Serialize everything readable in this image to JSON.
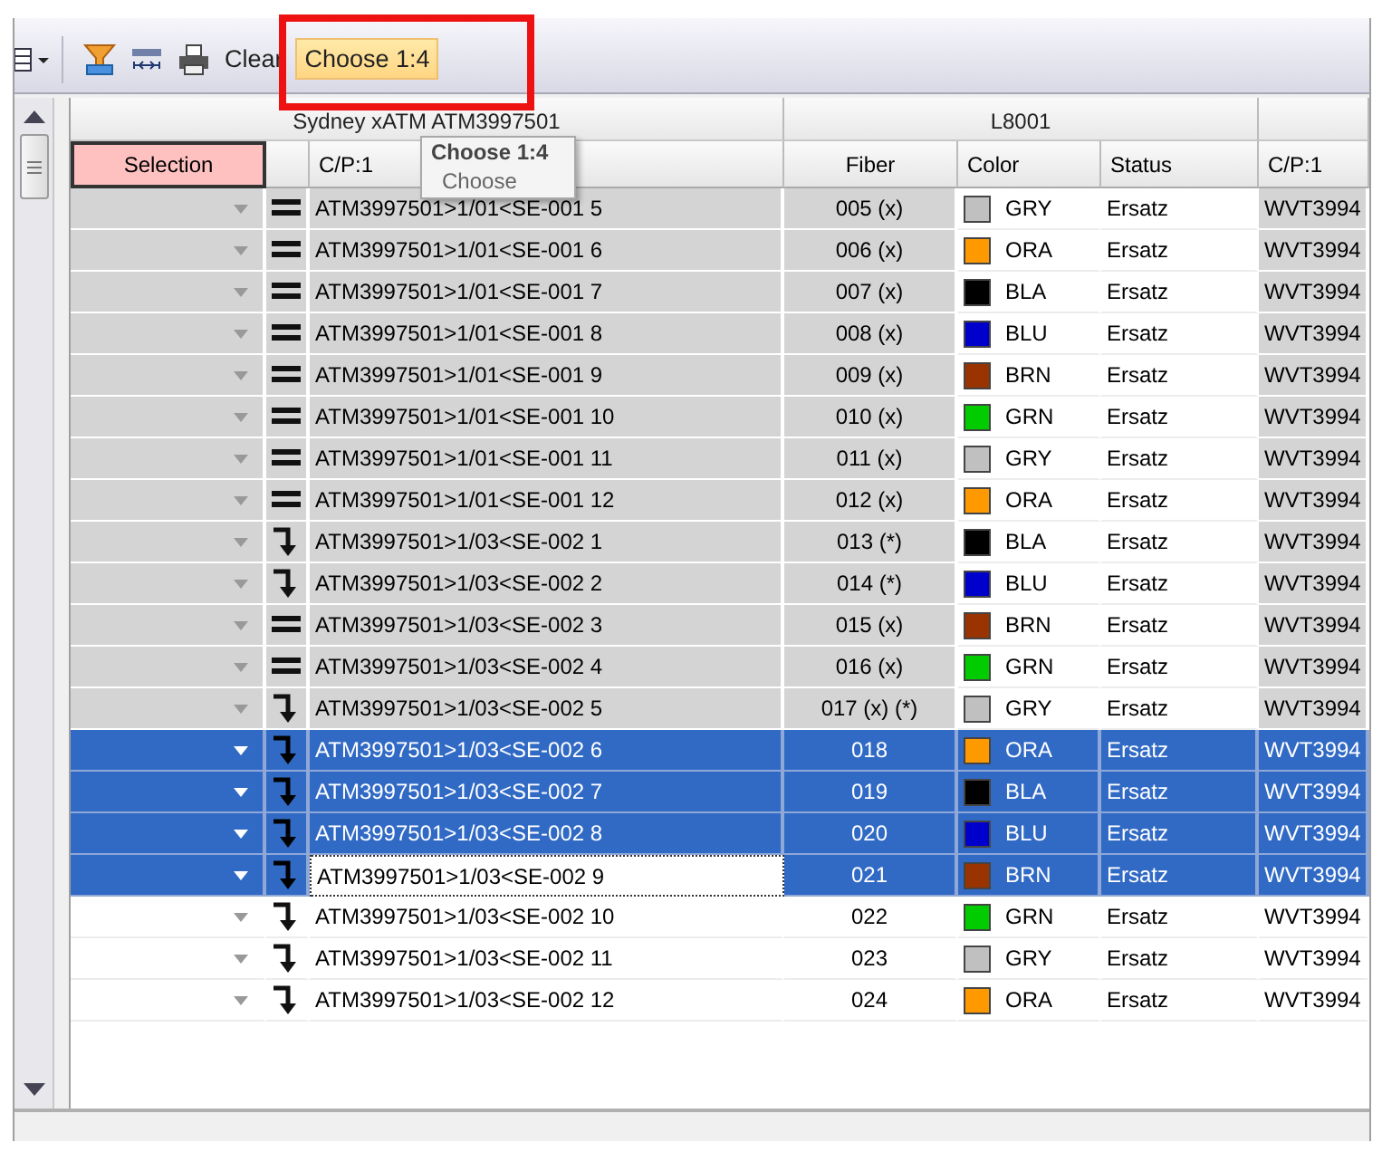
{
  "toolbar": {
    "clear_label": "Clear",
    "choose_button": {
      "label": "Choose 1:4",
      "hovered": true
    }
  },
  "tooltip": {
    "title": "Choose 1:4",
    "text": "Choose"
  },
  "grid": {
    "group_headers": [
      "Sydney xATM ATM3997501",
      "L8001"
    ],
    "columns": [
      {
        "label": "Selection",
        "selected": true
      },
      {
        "label": "C/P:1",
        "selected": false
      },
      {
        "label": "Fiber",
        "selected": false
      },
      {
        "label": "Color",
        "selected": false
      },
      {
        "label": "Status",
        "selected": false
      },
      {
        "label": "C/P:1",
        "selected": false
      }
    ],
    "rows": [
      {
        "kind": "equal",
        "cp": "ATM3997501>1/01<SE-001 5",
        "fiber": "005 (x)",
        "color": "#c0c0c0",
        "color_code": "GRY",
        "status": "Ersatz",
        "cp2": "WVT3994",
        "greyed": true,
        "selected": false,
        "focused": false
      },
      {
        "kind": "equal",
        "cp": "ATM3997501>1/01<SE-001 6",
        "fiber": "006 (x)",
        "color": "#ff9900",
        "color_code": "ORA",
        "status": "Ersatz",
        "cp2": "WVT3994",
        "greyed": true,
        "selected": false,
        "focused": false
      },
      {
        "kind": "equal",
        "cp": "ATM3997501>1/01<SE-001 7",
        "fiber": "007 (x)",
        "color": "#000000",
        "color_code": "BLA",
        "status": "Ersatz",
        "cp2": "WVT3994",
        "greyed": true,
        "selected": false,
        "focused": false
      },
      {
        "kind": "equal",
        "cp": "ATM3997501>1/01<SE-001 8",
        "fiber": "008 (x)",
        "color": "#0000cc",
        "color_code": "BLU",
        "status": "Ersatz",
        "cp2": "WVT3994",
        "greyed": true,
        "selected": false,
        "focused": false
      },
      {
        "kind": "equal",
        "cp": "ATM3997501>1/01<SE-001 9",
        "fiber": "009 (x)",
        "color": "#993300",
        "color_code": "BRN",
        "status": "Ersatz",
        "cp2": "WVT3994",
        "greyed": true,
        "selected": false,
        "focused": false
      },
      {
        "kind": "equal",
        "cp": "ATM3997501>1/01<SE-001 10",
        "fiber": "010 (x)",
        "color": "#00cc00",
        "color_code": "GRN",
        "status": "Ersatz",
        "cp2": "WVT3994",
        "greyed": true,
        "selected": false,
        "focused": false
      },
      {
        "kind": "equal",
        "cp": "ATM3997501>1/01<SE-001 11",
        "fiber": "011 (x)",
        "color": "#c0c0c0",
        "color_code": "GRY",
        "status": "Ersatz",
        "cp2": "WVT3994",
        "greyed": true,
        "selected": false,
        "focused": false
      },
      {
        "kind": "equal",
        "cp": "ATM3997501>1/01<SE-001 12",
        "fiber": "012 (x)",
        "color": "#ff9900",
        "color_code": "ORA",
        "status": "Ersatz",
        "cp2": "WVT3994",
        "greyed": true,
        "selected": false,
        "focused": false
      },
      {
        "kind": "turn",
        "cp": "ATM3997501>1/03<SE-002 1",
        "fiber": "013 (*)",
        "color": "#000000",
        "color_code": "BLA",
        "status": "Ersatz",
        "cp2": "WVT3994",
        "greyed": true,
        "selected": false,
        "focused": false
      },
      {
        "kind": "turn",
        "cp": "ATM3997501>1/03<SE-002 2",
        "fiber": "014 (*)",
        "color": "#0000cc",
        "color_code": "BLU",
        "status": "Ersatz",
        "cp2": "WVT3994",
        "greyed": true,
        "selected": false,
        "focused": false
      },
      {
        "kind": "equal",
        "cp": "ATM3997501>1/03<SE-002 3",
        "fiber": "015 (x)",
        "color": "#993300",
        "color_code": "BRN",
        "status": "Ersatz",
        "cp2": "WVT3994",
        "greyed": true,
        "selected": false,
        "focused": false
      },
      {
        "kind": "equal",
        "cp": "ATM3997501>1/03<SE-002 4",
        "fiber": "016 (x)",
        "color": "#00cc00",
        "color_code": "GRN",
        "status": "Ersatz",
        "cp2": "WVT3994",
        "greyed": true,
        "selected": false,
        "focused": false
      },
      {
        "kind": "turn",
        "cp": "ATM3997501>1/03<SE-002 5",
        "fiber": "017 (x) (*)",
        "color": "#c0c0c0",
        "color_code": "GRY",
        "status": "Ersatz",
        "cp2": "WVT3994",
        "greyed": true,
        "selected": false,
        "focused": false
      },
      {
        "kind": "turn",
        "cp": "ATM3997501>1/03<SE-002 6",
        "fiber": "018",
        "color": "#ff9900",
        "color_code": "ORA",
        "status": "Ersatz",
        "cp2": "WVT3994",
        "greyed": false,
        "selected": true,
        "focused": false
      },
      {
        "kind": "turn",
        "cp": "ATM3997501>1/03<SE-002 7",
        "fiber": "019",
        "color": "#000000",
        "color_code": "BLA",
        "status": "Ersatz",
        "cp2": "WVT3994",
        "greyed": false,
        "selected": true,
        "focused": false
      },
      {
        "kind": "turn",
        "cp": "ATM3997501>1/03<SE-002 8",
        "fiber": "020",
        "color": "#0000cc",
        "color_code": "BLU",
        "status": "Ersatz",
        "cp2": "WVT3994",
        "greyed": false,
        "selected": true,
        "focused": false
      },
      {
        "kind": "turn",
        "cp": "ATM3997501>1/03<SE-002 9",
        "fiber": "021",
        "color": "#993300",
        "color_code": "BRN",
        "status": "Ersatz",
        "cp2": "WVT3994",
        "greyed": false,
        "selected": true,
        "focused": true
      },
      {
        "kind": "turn",
        "cp": "ATM3997501>1/03<SE-002 10",
        "fiber": "022",
        "color": "#00cc00",
        "color_code": "GRN",
        "status": "Ersatz",
        "cp2": "WVT3994",
        "greyed": false,
        "selected": false,
        "focused": false
      },
      {
        "kind": "turn",
        "cp": "ATM3997501>1/03<SE-002 11",
        "fiber": "023",
        "color": "#c0c0c0",
        "color_code": "GRY",
        "status": "Ersatz",
        "cp2": "WVT3994",
        "greyed": false,
        "selected": false,
        "focused": false
      },
      {
        "kind": "turn",
        "cp": "ATM3997501>1/03<SE-002 12",
        "fiber": "024",
        "color": "#ff9900",
        "color_code": "ORA",
        "status": "Ersatz",
        "cp2": "WVT3994",
        "greyed": false,
        "selected": false,
        "focused": false
      }
    ]
  }
}
